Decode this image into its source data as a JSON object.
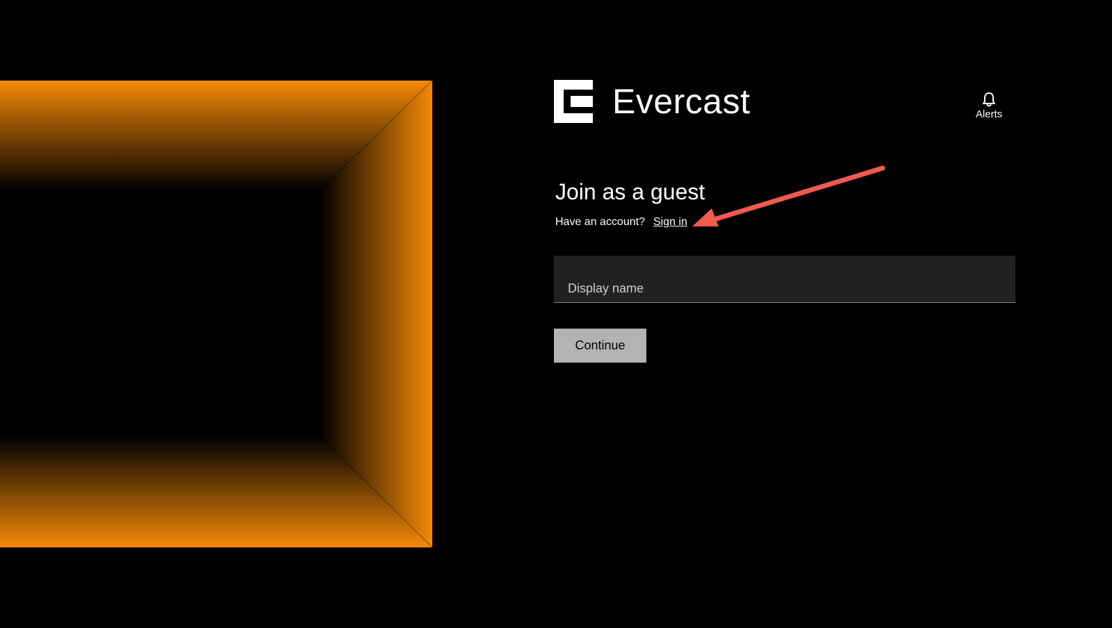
{
  "brand": {
    "name": "Evercast",
    "logo_icon": "evercast-e-logo",
    "accent_color": "#f58a07"
  },
  "header": {
    "alerts_label": "Alerts",
    "alerts_icon": "bell-icon"
  },
  "form": {
    "title": "Join as a guest",
    "account_prompt": "Have an account?",
    "signin_label": "Sign in",
    "display_name_placeholder": "Display name",
    "display_name_value": "",
    "continue_label": "Continue"
  },
  "annotation": {
    "type": "arrow",
    "color": "#f05a4f",
    "points_to": "signin-link"
  }
}
